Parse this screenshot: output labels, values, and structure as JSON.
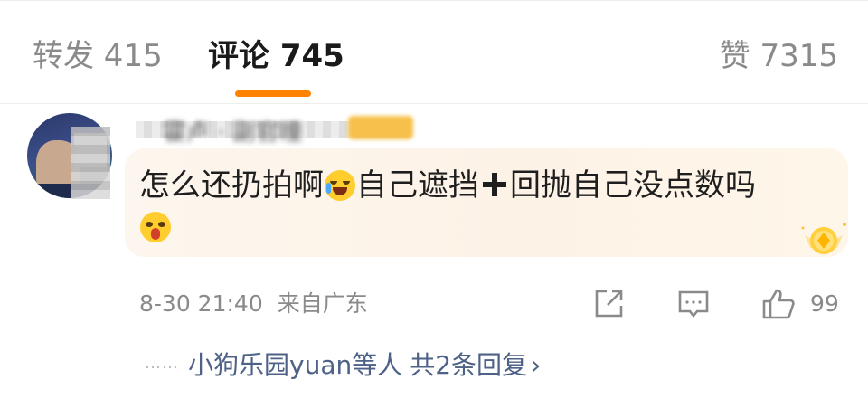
{
  "tabs": {
    "repost": "转发 415",
    "comment": "评论 745",
    "like": "赞 7315"
  },
  "comment": {
    "username": "霍卢 · 副官瞳",
    "text_part1": "怎么还扔拍啊",
    "text_part2": "自己遮挡",
    "text_part3": "回抛自己没点数吗",
    "timestamp": "8-30 21:40",
    "location": "来自广东",
    "like_count": "99"
  },
  "replies": {
    "dots": "……",
    "who": "小狗乐园yuan等人",
    "total": "共2条回复",
    "arrow": "›"
  },
  "icons": [
    "share-icon",
    "reply-icon",
    "thumb-up-icon",
    "tears-of-joy-emoji",
    "blushing-emoji",
    "medal-icon"
  ],
  "colors": {
    "accent": "#ff8200",
    "link": "#4e6186",
    "muted": "#8a8a8a"
  }
}
